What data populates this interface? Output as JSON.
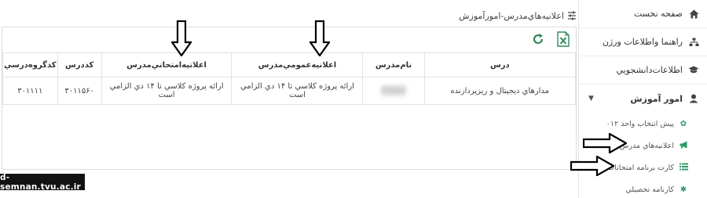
{
  "header": {
    "title": "اعلانيه‌هاي‌مدرس-امورآموزش",
    "title_icon": "tune-icon"
  },
  "toolbar": {
    "refresh_icon": "refresh-icon",
    "excel_icon": "excel-export-icon",
    "accent": "#2e8b57"
  },
  "table": {
    "columns": [
      "درس",
      "نام‌مدرس",
      "اعلانيه‌عمومي‌مدرس",
      "اعلانيه‌امتحاني‌مدرس",
      "كددرس",
      "كدگروه‌درسي"
    ],
    "rows": [
      {
        "course": "مدارهاي ديجيتال و ريزپردازنده",
        "teacher": "",
        "general_notice": "ارائه پروژه كلاسي تا ۱۴ دي الزامي است",
        "exam_notice": "ارائه پروژه كلاسي تا ۱۴ دي الزامي است",
        "course_code": "۳۰۱۱۵۶۰",
        "group_code": "۳۰۱۱۱۱"
      }
    ]
  },
  "sidebar": {
    "items": [
      {
        "label": "صفحه نخست",
        "icon": "home-icon"
      },
      {
        "label": "راهنما واطلاعات ورژن",
        "icon": "sitemap-icon"
      },
      {
        "label": "اطلاعات‌دانشجويي",
        "icon": "graduation-cap-icon"
      },
      {
        "label": "امور آموزش",
        "icon": "user-icon",
        "expanded": true
      }
    ],
    "subitems": [
      {
        "label": "پيش انتخاب واحد ۰۱۲",
        "icon": "cogs-icon"
      },
      {
        "label": "اعلانيه‌هاي مدرس",
        "icon": "bullhorn-icon"
      },
      {
        "label": "کارت برنامه امتحانات",
        "icon": "list-icon"
      },
      {
        "label": "کارنامه تحصيلي",
        "icon": "asterisk-icon"
      }
    ]
  },
  "watermark": {
    "text": "d-semnan.tvu.ac.ir"
  }
}
